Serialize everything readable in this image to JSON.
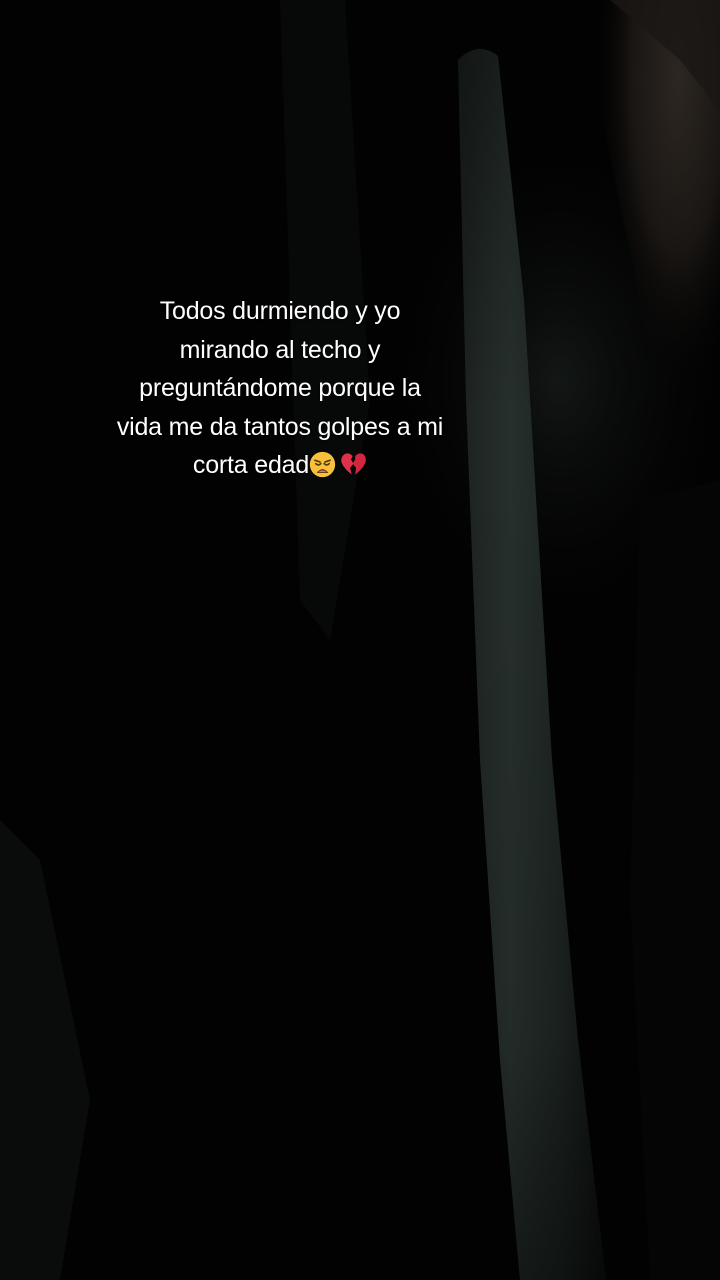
{
  "caption": {
    "lines": [
      "Todos durmiendo y yo",
      "mirando al techo y",
      "preguntándome porque la",
      "vida me da tantos golpes a mi",
      "corta edad"
    ],
    "emojis": [
      "weary-face-icon",
      "broken-heart-icon"
    ]
  },
  "colors": {
    "background": "#020202",
    "text": "#ffffff",
    "emoji_face": "#f7c23a",
    "emoji_heart": "#e0314b"
  }
}
